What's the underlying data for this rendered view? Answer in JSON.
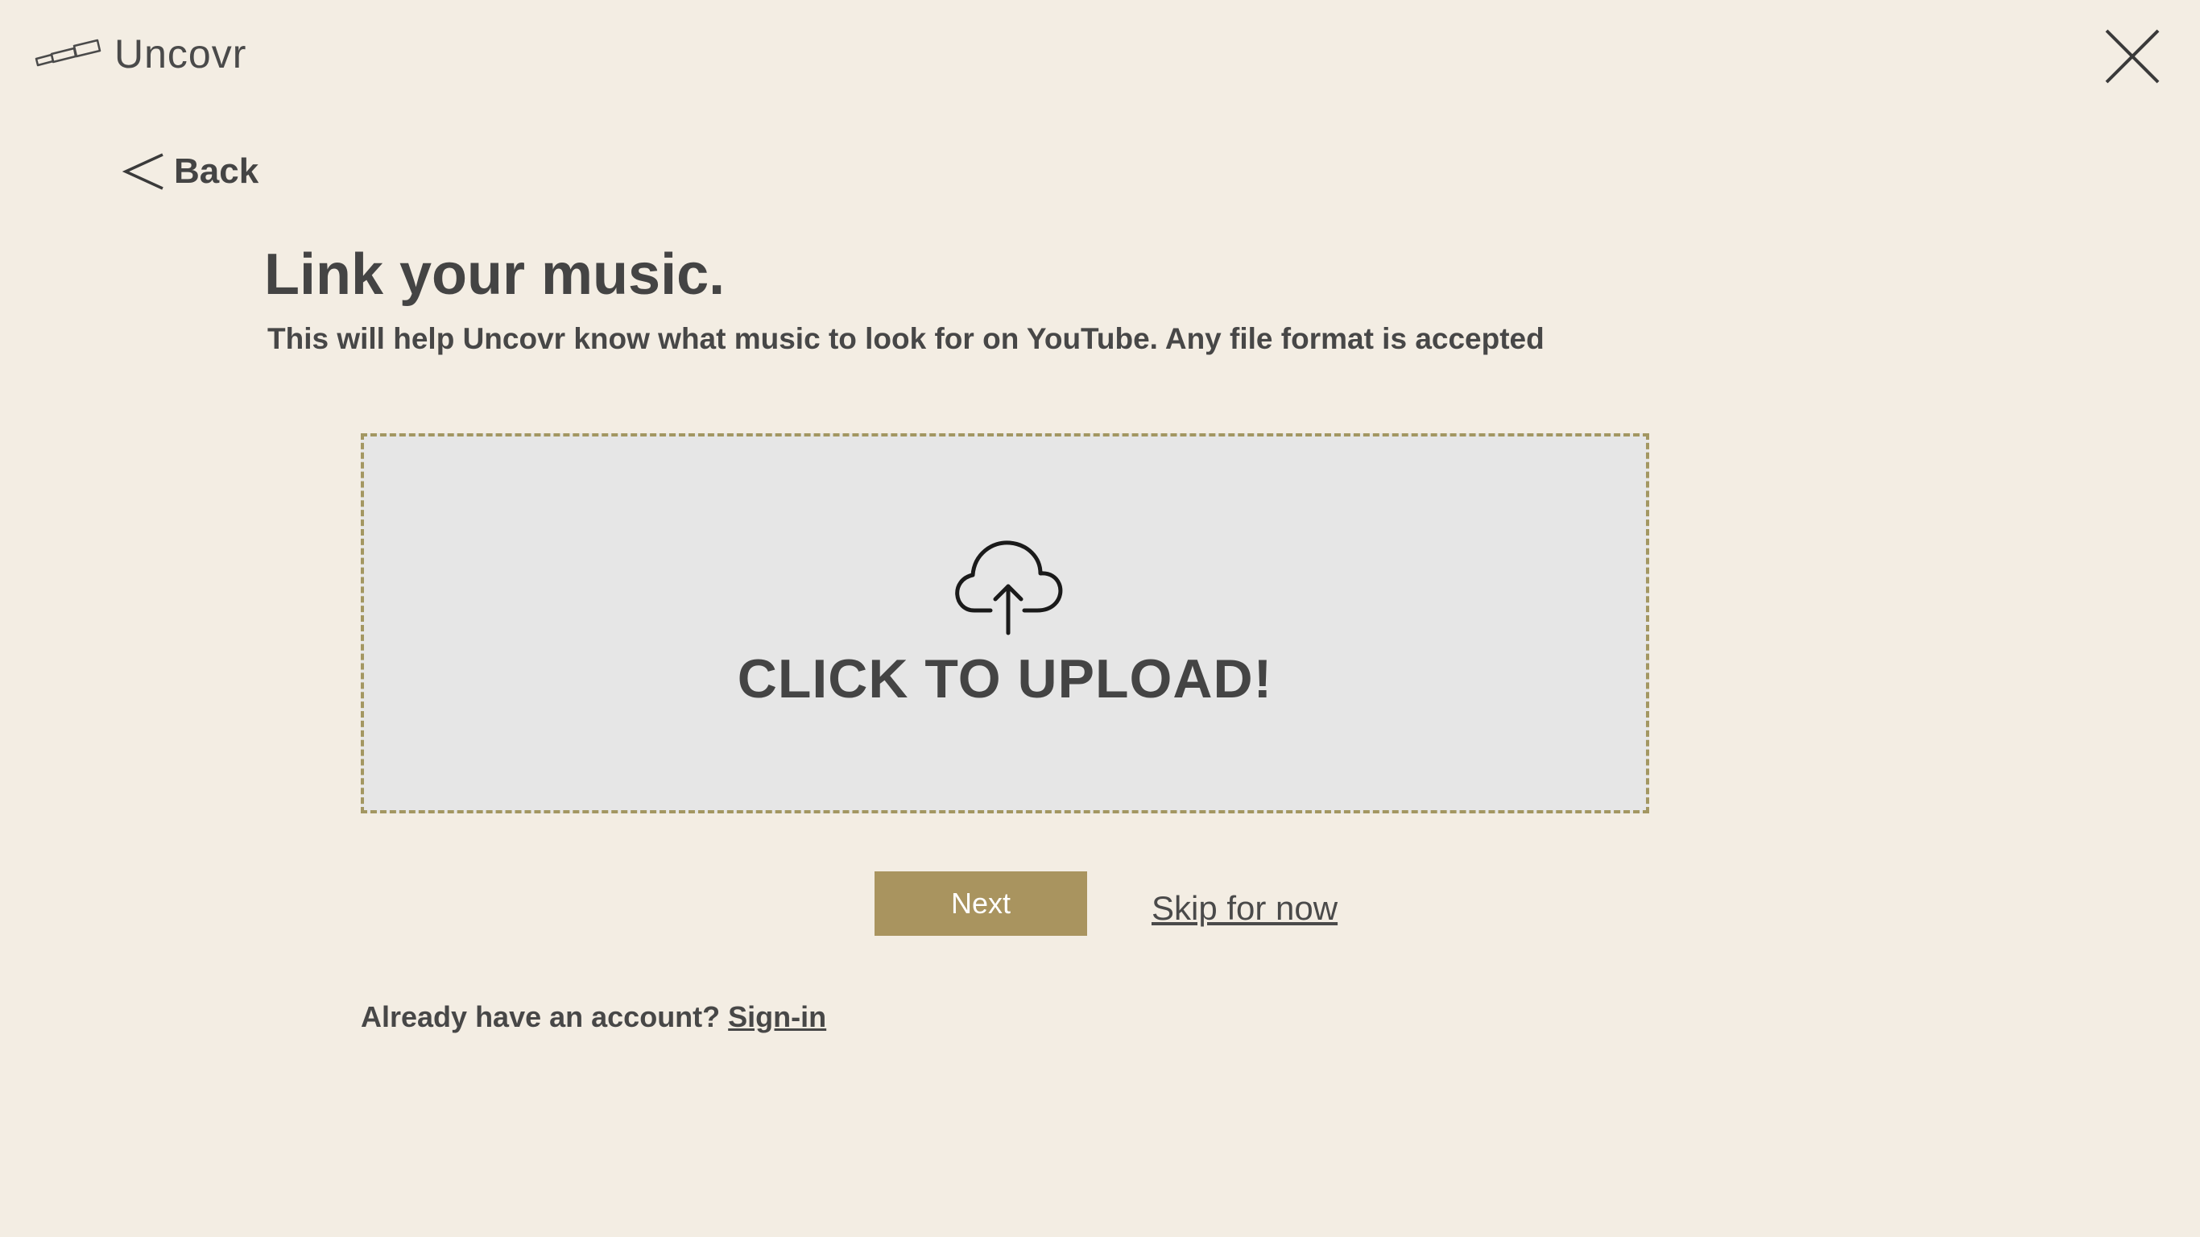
{
  "app": {
    "name": "Uncovr",
    "logo_icon": "telescope-icon",
    "close_icon": "close-icon"
  },
  "nav": {
    "back_label": "Back",
    "back_icon": "chevron-left-icon"
  },
  "main": {
    "title": "Link your music.",
    "subtitle": "This will help Uncovr know what music to look for on YouTube. Any file format is accepted"
  },
  "upload": {
    "label": "CLICK TO UPLOAD!",
    "icon": "cloud-upload-icon"
  },
  "actions": {
    "next_label": "Next",
    "skip_label": "Skip for now"
  },
  "footer": {
    "account_prompt": "Already have an account?",
    "signin_label": "Sign-in"
  },
  "colors": {
    "background": "#f3ede3",
    "upload_background": "#e6e6e6",
    "upload_border": "#a39762",
    "accent": "#a9945f",
    "text": "#444444"
  }
}
